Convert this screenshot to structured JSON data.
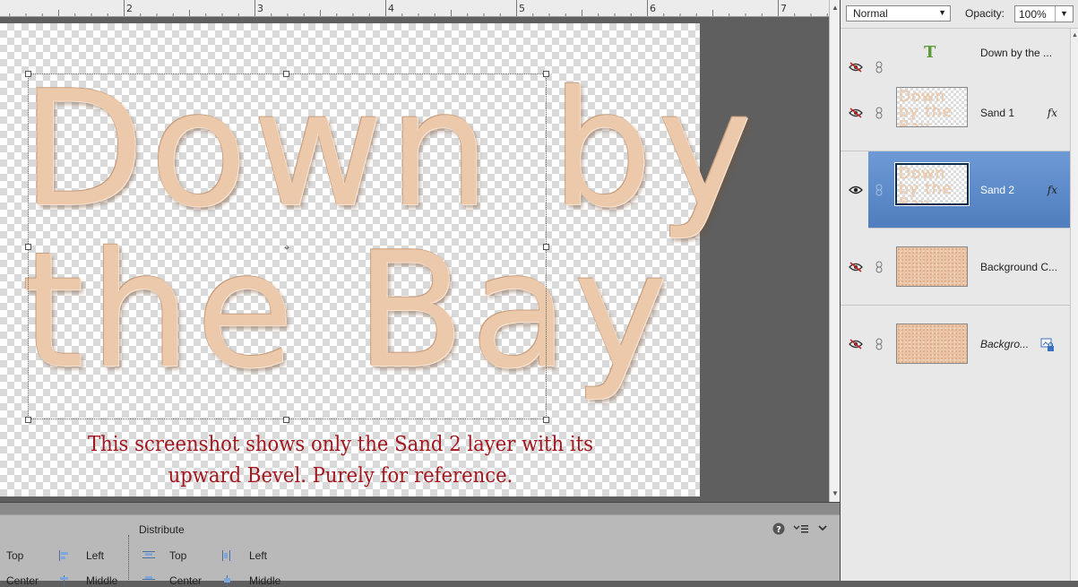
{
  "ruler": {
    "numbers": [
      "2",
      "3",
      "4",
      "5",
      "6",
      "7"
    ]
  },
  "canvas": {
    "text_line1": "Down by",
    "text_line2": "the Bay",
    "caption_line1": "This screenshot shows only the Sand 2 layer with its",
    "caption_line2": "upward Bevel. Purely for reference."
  },
  "options": {
    "section_title": "Distribute",
    "align_top": "Top",
    "align_left": "Left",
    "align_center": "Center",
    "align_middle": "Middle",
    "dist_top": "Top",
    "dist_left": "Left",
    "dist_center": "Center",
    "dist_middle": "Middle"
  },
  "layers_panel": {
    "blend_mode": "Normal",
    "opacity_label": "Opacity:",
    "opacity_value": "100%",
    "layers": [
      {
        "name": "Down by the ...",
        "type": "text",
        "visible": false,
        "fx": ""
      },
      {
        "name": "Sand 1",
        "type": "pixel",
        "visible": false,
        "fx": "fx",
        "thumb_text": "Down by the Bay"
      },
      {
        "name": "Sand 2",
        "type": "pixel",
        "visible": true,
        "selected": true,
        "fx": "fx",
        "thumb_text": "Down by the Bay"
      },
      {
        "name": "Background C...",
        "type": "pixel",
        "visible": false,
        "fx": ""
      },
      {
        "name": "Backgro...",
        "type": "background",
        "visible": false,
        "fx": "",
        "locked": true
      }
    ]
  },
  "colors": {
    "caption": "#a3181f",
    "sand": "#ecc9aa",
    "selected_layer": "#5a88c8"
  }
}
